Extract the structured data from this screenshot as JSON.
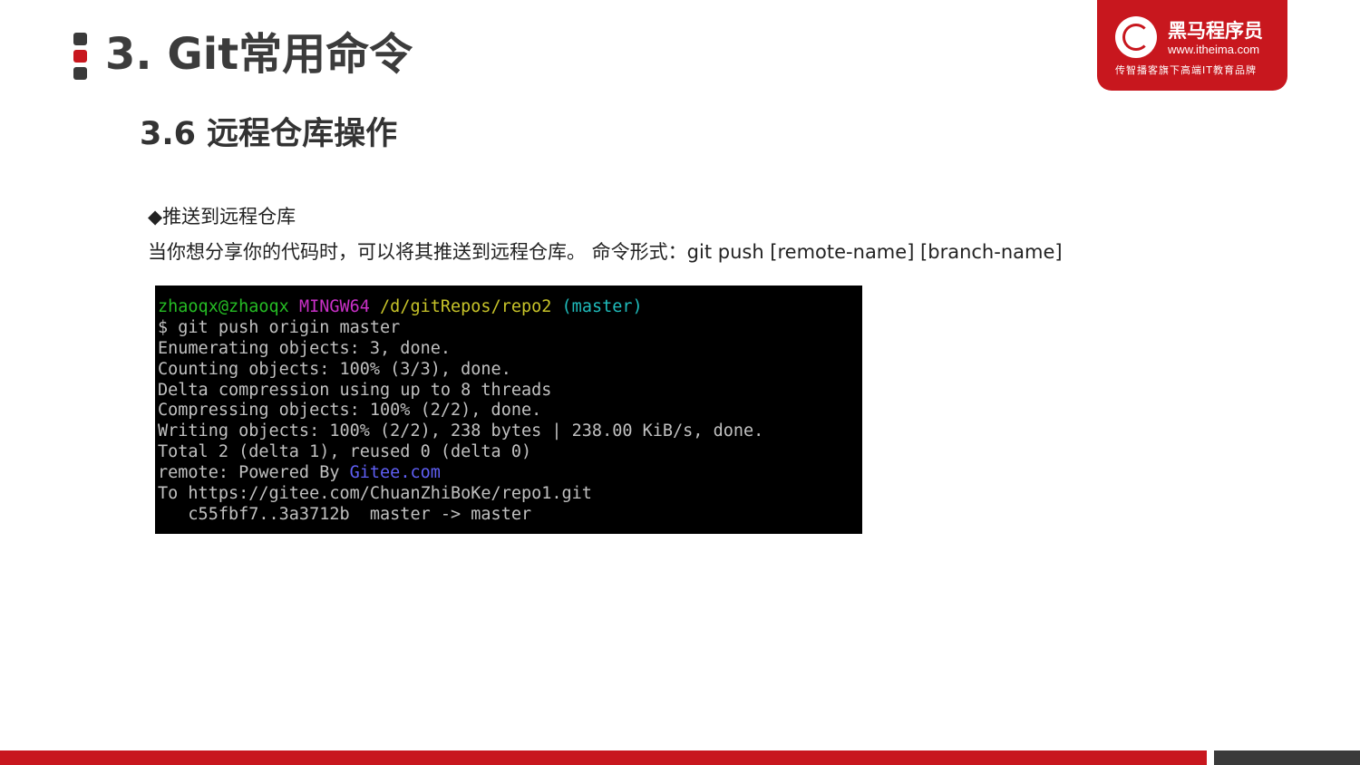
{
  "header": {
    "title": "3. Git常用命令",
    "subtitle": "3.6 远程仓库操作"
  },
  "logo": {
    "name": "黑马程序员",
    "url": "www.itheima.com",
    "tagline": "传智播客旗下高端IT教育品牌"
  },
  "content": {
    "bullet": "◆推送到远程仓库",
    "description": "当你想分享你的代码时，可以将其推送到远程仓库。 命令形式：git push [remote-name] [branch-name]"
  },
  "terminal": {
    "prompt_user": "zhaoqx@zhaoqx",
    "prompt_system": "MINGW64",
    "prompt_path": "/d/gitRepos/repo2",
    "prompt_branch": "(master)",
    "lines": [
      "$ git push origin master",
      "Enumerating objects: 3, done.",
      "Counting objects: 100% (3/3), done.",
      "Delta compression using up to 8 threads",
      "Compressing objects: 100% (2/2), done.",
      "Writing objects: 100% (2/2), 238 bytes | 238.00 KiB/s, done.",
      "Total 2 (delta 1), reused 0 (delta 0)"
    ],
    "remote_prefix": "remote: Powered By ",
    "remote_link": "Gitee.com",
    "push_target": "To https://gitee.com/ChuanZhiBoKe/repo1.git",
    "push_result": "   c55fbf7..3a3712b  master -> master"
  },
  "colors": {
    "brand_red": "#c8171e",
    "dark_gray": "#3a3a3a",
    "terminal_bg": "#000000",
    "terminal_text": "#c0c0c0",
    "prompt_user": "#25bc24",
    "prompt_system": "#c930c7",
    "prompt_path": "#c7c329",
    "prompt_branch": "#1fbcbc",
    "link": "#5f5ff5"
  }
}
